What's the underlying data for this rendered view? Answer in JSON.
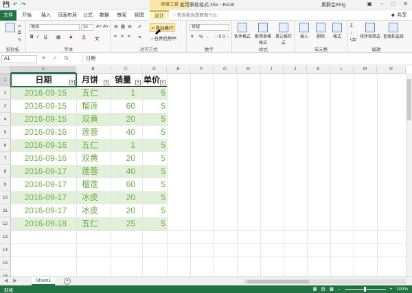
{
  "titlebar": {
    "context_tab": "表格工具",
    "document_title": "套用表格格式.xlsx - Excel",
    "user": "奥群会King",
    "qat_icons": [
      "save-icon",
      "undo-icon",
      "redo-icon"
    ],
    "window_controls": [
      "ribbon-display-icon",
      "minimize-icon",
      "restore-icon",
      "close-icon"
    ]
  },
  "tabs": {
    "file": "文件",
    "home": "开始",
    "insert": "插入",
    "page_layout": "页面布局",
    "formulas": "公式",
    "data": "数据",
    "review": "审阅",
    "view": "视图",
    "design": "设计",
    "tell_me": "告诉我你想要做什么",
    "share": "共享"
  },
  "ribbon": {
    "clipboard": {
      "label": "剪贴板"
    },
    "font": {
      "label": "字体",
      "font_name": "等线",
      "font_size": "20",
      "bold": "B",
      "italic": "I",
      "underline": "U"
    },
    "alignment": {
      "label": "对齐方式",
      "wrap_text": "自动换行",
      "merge_center": "合并后居中"
    },
    "number": {
      "label": "数字",
      "format": "常规",
      "percent": "%",
      "comma": ","
    },
    "styles": {
      "label": "样式",
      "conditional": "条件格式",
      "format_table": "套用表格格式",
      "cell_styles": "单元格样式"
    },
    "cells": {
      "label": "单元格",
      "insert": "插入",
      "delete": "删除",
      "format": "格式"
    },
    "editing": {
      "label": "编辑",
      "sort_filter": "排序和筛选",
      "find_select": "查找和选择"
    }
  },
  "formula_bar": {
    "name_box": "A1",
    "content": "日期"
  },
  "grid": {
    "columns": [
      "A",
      "B",
      "C",
      "D",
      "E",
      "F",
      "G",
      "H",
      "I",
      "J",
      "K",
      "L",
      "M",
      "N"
    ],
    "rows": [
      "1",
      "2",
      "3",
      "4",
      "5",
      "6",
      "7",
      "8",
      "9",
      "10",
      "11",
      "12",
      "13",
      "14",
      "15",
      "16"
    ],
    "selected_cell": "A1",
    "headers": [
      "日期",
      "月饼",
      "销量",
      "单价"
    ],
    "data": [
      [
        "2016-09-15",
        "五仁",
        "1",
        "5"
      ],
      [
        "2016-09-15",
        "榴莲",
        "60",
        "5"
      ],
      [
        "2016-09-15",
        "双黄",
        "20",
        "5"
      ],
      [
        "2016-09-16",
        "莲蓉",
        "40",
        "5"
      ],
      [
        "2016-09-16",
        "五仁",
        "1",
        "5"
      ],
      [
        "2016-09-16",
        "双黄",
        "20",
        "5"
      ],
      [
        "2016-09-17",
        "莲蓉",
        "40",
        "5"
      ],
      [
        "2016-09-17",
        "榴莲",
        "60",
        "5"
      ],
      [
        "2016-09-17",
        "冰皮",
        "20",
        "5"
      ],
      [
        "2016-09-17",
        "冰皮",
        "20",
        "5"
      ],
      [
        "2016-09-18",
        "五仁",
        "25",
        "5"
      ]
    ],
    "band_color": "#e2efda",
    "data_text_color": "#70ad47"
  },
  "sheets": {
    "active": "Sheet1"
  },
  "status": {
    "ready": "就绪",
    "zoom": "100%"
  },
  "colors": {
    "excel_green": "#217346",
    "context_yellow": "#fbe6a8"
  }
}
